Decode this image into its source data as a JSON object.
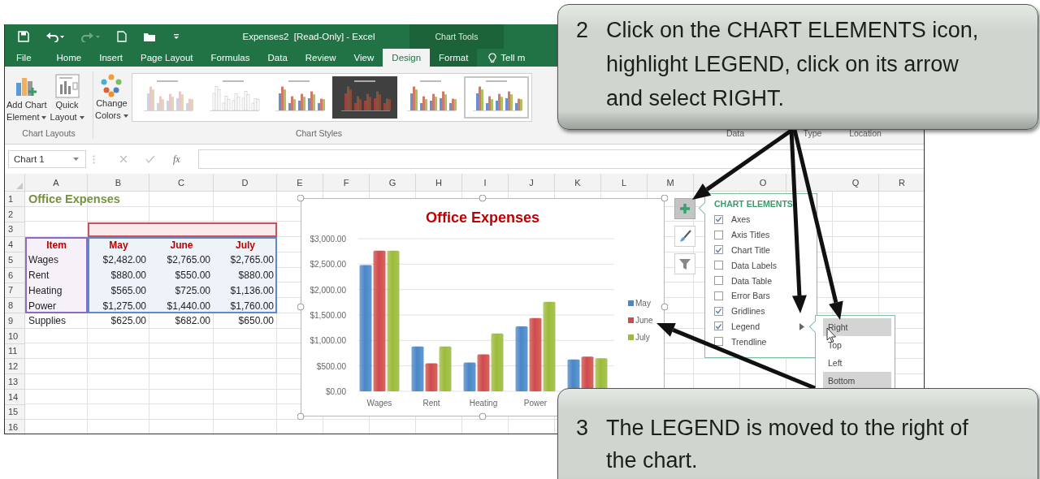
{
  "window": {
    "title": "Expenses2  [Read-Only] - Excel",
    "contextual_group": "Chart Tools"
  },
  "ribbon_tabs": [
    {
      "label": "File",
      "selected": false
    },
    {
      "label": "Home",
      "selected": false
    },
    {
      "label": "Insert",
      "selected": false
    },
    {
      "label": "Page Layout",
      "selected": false
    },
    {
      "label": "Formulas",
      "selected": false
    },
    {
      "label": "Data",
      "selected": false
    },
    {
      "label": "Review",
      "selected": false
    },
    {
      "label": "View",
      "selected": false
    },
    {
      "label": "Design",
      "selected": true
    },
    {
      "label": "Format",
      "selected": false
    }
  ],
  "tell_me": "Tell m",
  "ribbon": {
    "layout_buttons": [
      {
        "kind": "add-element",
        "lines": [
          "Add Chart",
          "Element"
        ]
      },
      {
        "kind": "quick-layout",
        "lines": [
          "Quick",
          "Layout"
        ]
      }
    ],
    "colors_button": {
      "lines": [
        "Change",
        "Colors"
      ]
    },
    "style_thumbnails": [
      {
        "kind": "faded",
        "selected": false
      },
      {
        "kind": "outline",
        "selected": false
      },
      {
        "kind": "light",
        "selected": false
      },
      {
        "kind": "dark",
        "selected": false
      },
      {
        "kind": "light",
        "selected": false
      },
      {
        "kind": "light",
        "selected": true
      }
    ],
    "group_labels": [
      "Chart Layouts",
      "Chart Styles",
      "Data",
      "Type",
      "Location"
    ]
  },
  "formula_bar": {
    "name_box": "Chart 1",
    "function_label": "fx"
  },
  "sheet": {
    "columns": [
      "A",
      "B",
      "C",
      "D",
      "E",
      "F",
      "G",
      "H",
      "I",
      "J",
      "K",
      "L",
      "M",
      null,
      "O",
      null,
      "Q",
      "R"
    ],
    "rows": [
      "1",
      "2",
      "3",
      "4",
      "5",
      "6",
      "7",
      "8",
      "9",
      "10",
      "11",
      "12",
      "13",
      "14",
      "15",
      "16"
    ],
    "title": "Office Expenses",
    "table": {
      "header": [
        "Item",
        "May",
        "June",
        "July"
      ],
      "rows": [
        [
          "Wages",
          "$2,482.00",
          "$2,765.00",
          "$2,765.00"
        ],
        [
          "Rent",
          "$880.00",
          "$550.00",
          "$880.00"
        ],
        [
          "Heating",
          "$565.00",
          "$725.00",
          "$1,136.00"
        ],
        [
          "Power",
          "$1,275.00",
          "$1,440.00",
          "$1,760.00"
        ],
        [
          "Supplies",
          "$625.00",
          "$682.00",
          "$650.00"
        ]
      ]
    }
  },
  "chart": {
    "chart_data": {
      "type": "bar",
      "title": "Office Expenses",
      "categories": [
        "Wages",
        "Rent",
        "Heating",
        "Power",
        null
      ],
      "series": [
        {
          "name": "May",
          "color": "#4a86c8",
          "values": [
            2482,
            880,
            565,
            1275,
            625
          ]
        },
        {
          "name": "June",
          "color": "#d04a4a",
          "values": [
            2765,
            550,
            725,
            1440,
            682
          ]
        },
        {
          "name": "July",
          "color": "#9bbb3a",
          "values": [
            2765,
            880,
            1136,
            1760,
            650
          ]
        }
      ],
      "ylim": [
        0,
        3000
      ],
      "yticks": [
        {
          "value": 0,
          "label": "$0.00"
        },
        {
          "value": 500,
          "label": "$500.00"
        },
        {
          "value": 1000,
          "label": "$1,000.00"
        },
        {
          "value": 1500,
          "label": "$1,500.00"
        },
        {
          "value": 2000,
          "label": "$2,000.00"
        },
        {
          "value": 2500,
          "label": "$2,500.00"
        },
        {
          "value": 3000,
          "label": "$3,000.00"
        }
      ],
      "grid": true,
      "legend": true
    }
  },
  "chart_buttons": [
    {
      "kind": "elements",
      "selected": true
    },
    {
      "kind": "styles",
      "selected": false
    },
    {
      "kind": "filters",
      "selected": false
    }
  ],
  "elements_panel": {
    "title": "CHART ELEMENTS",
    "items": [
      {
        "label": "Axes",
        "checked": true,
        "arrow": false
      },
      {
        "label": "Axis Titles",
        "checked": false,
        "arrow": false
      },
      {
        "label": "Chart Title",
        "checked": true,
        "arrow": false
      },
      {
        "label": "Data Labels",
        "checked": false,
        "arrow": false
      },
      {
        "label": "Data Table",
        "checked": false,
        "arrow": false
      },
      {
        "label": "Error Bars",
        "checked": false,
        "arrow": false
      },
      {
        "label": "Gridlines",
        "checked": true,
        "arrow": false
      },
      {
        "label": "Legend",
        "checked": true,
        "arrow": true
      },
      {
        "label": "Trendline",
        "checked": false,
        "arrow": false
      }
    ]
  },
  "legend_submenu": [
    {
      "label": "Right",
      "highlighted": true
    },
    {
      "label": "Top",
      "highlighted": false
    },
    {
      "label": "Left",
      "highlighted": false
    },
    {
      "label": "Bottom",
      "highlighted": true
    }
  ],
  "callouts": [
    {
      "number": "2",
      "text": "Click on the CHART ELEMENTS icon, highlight LEGEND, click on its arrow and select RIGHT."
    },
    {
      "number": "3",
      "text": "The LEGEND is moved to the right of the chart."
    }
  ]
}
